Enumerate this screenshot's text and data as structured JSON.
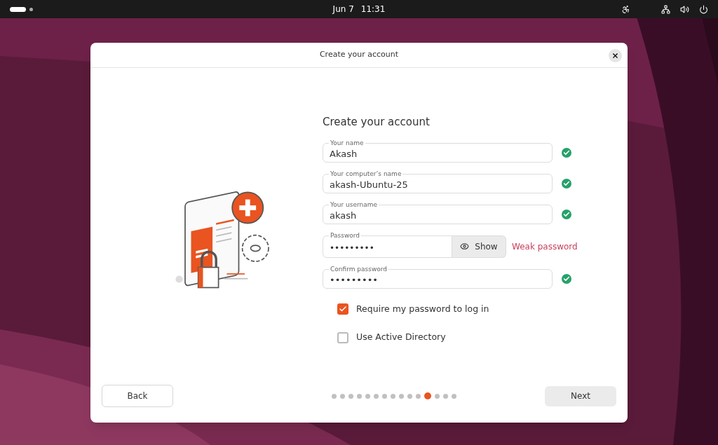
{
  "top_bar": {
    "date": "Jun 7",
    "time": "11:31",
    "workspaces": [
      {
        "selected": true
      },
      {
        "selected": false
      }
    ]
  },
  "dialog": {
    "title": "Create your account",
    "heading": "Create your account",
    "fields": [
      {
        "kind": "text",
        "label": "Your name",
        "value": "Akash",
        "valid": true
      },
      {
        "kind": "text",
        "label": "Your computer’s name",
        "value": "akash-Ubuntu-25",
        "valid": true
      },
      {
        "kind": "text",
        "label": "Your username",
        "value": "akash",
        "valid": true
      },
      {
        "kind": "password",
        "label": "Password",
        "value": "•••••••••",
        "button": "Show",
        "valid": false,
        "message": "Weak password"
      },
      {
        "kind": "password",
        "label": "Confirm password",
        "value": "•••••••••",
        "valid": true
      }
    ],
    "checkboxes": [
      {
        "label": "Require my password to log in",
        "checked": true
      },
      {
        "label": "Use Active Directory",
        "checked": false
      }
    ],
    "back": "Back",
    "next": "Next",
    "steps": [
      {
        "selected": false
      },
      {
        "selected": false
      },
      {
        "selected": false
      },
      {
        "selected": false
      },
      {
        "selected": false
      },
      {
        "selected": false
      },
      {
        "selected": false
      },
      {
        "selected": false
      },
      {
        "selected": false
      },
      {
        "selected": false
      },
      {
        "selected": false
      },
      {
        "selected": true
      },
      {
        "selected": false
      },
      {
        "selected": false
      },
      {
        "selected": false
      }
    ]
  }
}
